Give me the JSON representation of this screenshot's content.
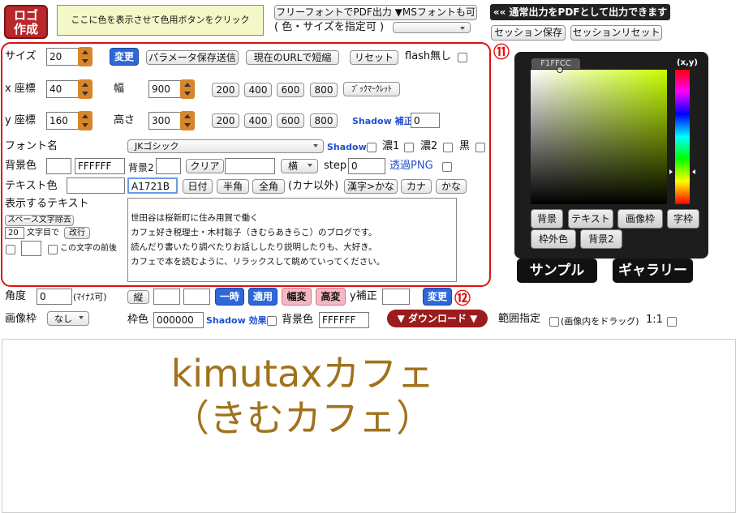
{
  "top": {
    "logo_label": "ロゴ\n作成",
    "color_hint": "ここに色を表示させて色用ボタンをクリック",
    "pdf_button": "フリーフォントでPDF出力 ▼MSフォントも可",
    "pdf_size_text": "( 色・サイズを指定可 )",
    "pdf_note": "«« 通常出力をPDFとして出力できます",
    "session_save": "セッション保存",
    "session_reset": "セッションリセット",
    "marker11": "⑪",
    "marker12": "⑫"
  },
  "settings": {
    "size_label": "サイズ",
    "size_value": "20",
    "change_btn": "変更",
    "param_btn": "パラメータ保存送信",
    "url_btn": "現在のURLで短縮",
    "reset_btn": "リセット",
    "flash_label": "flash無し",
    "x_label": "x 座標",
    "x_value": "40",
    "width_label": "幅",
    "width_value": "900",
    "width_presets": [
      "200",
      "400",
      "600",
      "800"
    ],
    "bookmarklet_btn": "ﾌﾞｯｸﾏｰｸﾚｯﾄ",
    "y_label": "y 座標",
    "y_value": "160",
    "height_label": "高さ",
    "height_value": "300",
    "height_presets": [
      "200",
      "400",
      "600",
      "800"
    ],
    "shadow_fix_label": "Shadow 補正",
    "shadow_fix_value": "0",
    "font_label": "フォント名",
    "font_value": "JKゴシック",
    "shadow_label": "Shadow",
    "dark1": "濃1",
    "dark2": "濃2",
    "black": "黒",
    "bg_label": "背景色",
    "bg_value": "FFFFFF",
    "bg2_label": "背景2",
    "clear_btn": "クリア",
    "direction_value": "横",
    "step_label": "step",
    "step_value": "0",
    "transparent_label": "透過PNG",
    "text_color_label": "テキスト色",
    "text_color_value": "A1721B",
    "date_btn": "日付",
    "half_btn": "半角",
    "full_btn": "全角",
    "kana_note": "(カナ以外)",
    "kanji_btn": "漢字>かな",
    "kana_btn": "カナ",
    "hira_btn": "かな",
    "display_text_label": "表示するテキスト",
    "space_remove_btn": "スペース文字除去",
    "wrap_value": "20",
    "wrap_label": "文字目で",
    "wrap_btn": "改行",
    "before_char_label": "この文字の前後",
    "textarea_lines": [
      "世田谷は桜新町に住み用賀で働く",
      "カフェ好き税理士・木村聡子（きむらあきらこ）のブログです。",
      "読んだり書いたり調べたりお話ししたり説明したりも、大好き。",
      "カフェで本を読むように、リラックスして眺めていってください。"
    ]
  },
  "picker": {
    "hex_value": "F1FFCC",
    "xy_label": "(x,y)",
    "buttons_row1": [
      "背景",
      "テキスト",
      "画像枠",
      "字枠"
    ],
    "buttons_row2": [
      "枠外色",
      "背景2"
    ],
    "sample_btn": "サンプル",
    "gallery_btn": "ギャラリー"
  },
  "lower": {
    "angle_label": "角度",
    "angle_value": "0",
    "minus_note": "(ﾏｲﾅｽ可)",
    "vertical_btn": "縦",
    "temp_btn": "一時",
    "apply_btn": "適用",
    "width_change_btn": "幅変",
    "height_change_btn": "高変",
    "y_fix_label": "y補正",
    "change_btn": "変更",
    "frame_label": "画像枠",
    "frame_value": "なし",
    "border_color_label": "枠色",
    "border_color_value": "000000",
    "shadow_effect_label": "Shadow 効果",
    "bg_color_label": "背景色",
    "bg_color_value": "FFFFFF",
    "download_btn": "▼ ダウンロード ▼",
    "range_label": "範囲指定",
    "drag_note": "(画像内をドラッグ)",
    "ratio_label": "1:1"
  },
  "preview": {
    "line1": "kimutaxカフェ",
    "line2": "（きむカフェ）",
    "text_color": "#A1721B"
  }
}
